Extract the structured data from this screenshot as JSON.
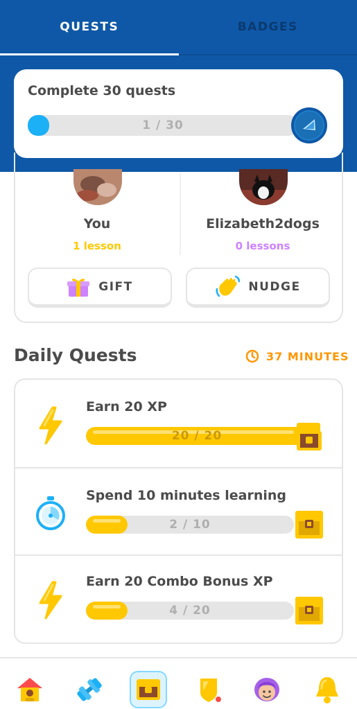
{
  "tabs": [
    {
      "label": "QUESTS",
      "active": true
    },
    {
      "label": "BADGES",
      "active": false
    }
  ],
  "monthly_challenge": {
    "title": "Complete 30 quests",
    "progress_text": "1 / 30",
    "current": 1,
    "total": 30,
    "fill_color": "#1cb0f6"
  },
  "friend_quest": {
    "you": {
      "name": "You",
      "subtitle": "1 lesson",
      "subtitle_color": "#ffc800"
    },
    "friend": {
      "name": "Elizabeth2dogs",
      "subtitle": "0 lessons",
      "subtitle_color": "#ce82ff"
    },
    "gift_label": "GIFT",
    "nudge_label": "NUDGE"
  },
  "daily_quests": {
    "title": "Daily Quests",
    "timer": "37 MINUTES",
    "accent": "#ff9600",
    "quests": [
      {
        "label": "Earn 20 XP",
        "progress_text": "20 / 20",
        "current": 20,
        "total": 20,
        "icon": "lightning-icon",
        "completed": true
      },
      {
        "label": "Spend 10 minutes learning",
        "progress_text": "2 / 10",
        "current": 2,
        "total": 10,
        "icon": "stopwatch-icon",
        "completed": false
      },
      {
        "label": "Earn 20 Combo Bonus XP",
        "progress_text": "4 / 20",
        "current": 4,
        "total": 20,
        "icon": "lightning-icon",
        "completed": false
      }
    ]
  },
  "bottom_nav": [
    {
      "name": "home-icon",
      "active": false
    },
    {
      "name": "practice-icon",
      "active": false
    },
    {
      "name": "quests-chest-icon",
      "active": true
    },
    {
      "name": "league-shield-icon",
      "active": false
    },
    {
      "name": "profile-icon",
      "active": false
    },
    {
      "name": "notifications-bell-icon",
      "active": false
    }
  ],
  "colors": {
    "header_blue": "#0f58a7",
    "gold": "#ffc800",
    "track_gray": "#e5e5e5"
  }
}
